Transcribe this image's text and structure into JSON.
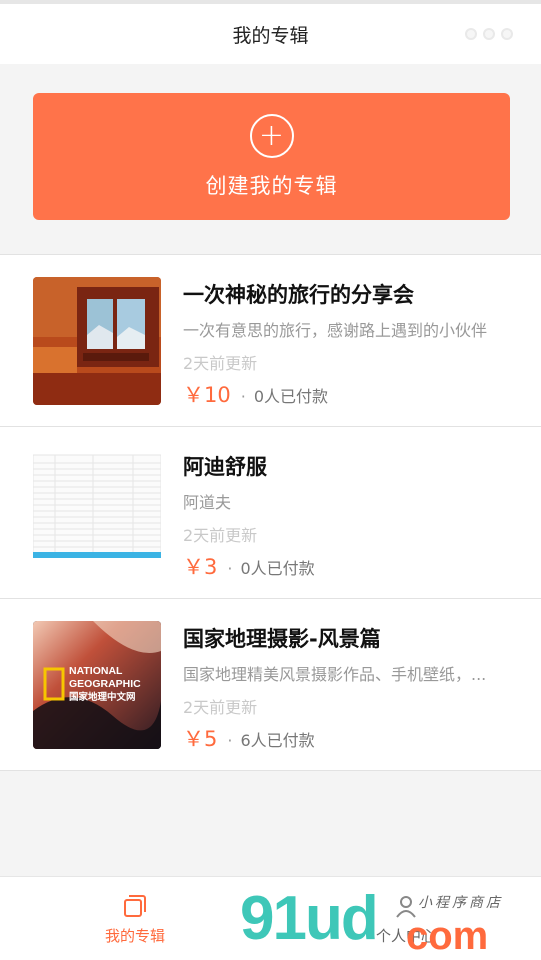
{
  "header": {
    "title": "我的专辑"
  },
  "create": {
    "label": "创建我的专辑",
    "icon": "plus-circle-icon"
  },
  "albums": [
    {
      "title": "一次神秘的旅行的分享会",
      "description": "一次有意思的旅行，感谢路上遇到的小伙伴",
      "updated": "2天前更新",
      "price": "￥10",
      "paid": "0人已付款"
    },
    {
      "title": "阿迪舒服",
      "description": "阿道夫",
      "updated": "2天前更新",
      "price": "￥3",
      "paid": "0人已付款"
    },
    {
      "title": "国家地理摄影-风景篇",
      "description": "国家地理精美风景摄影作品、手机壁纸，...",
      "updated": "2天前更新",
      "price": "￥5",
      "paid": "6人已付款",
      "thumb_text": [
        "NATIONAL",
        "GEOGRAPHIC",
        "国家地理中文网"
      ]
    }
  ],
  "tabbar": {
    "tabs": [
      {
        "label": "我的专辑",
        "icon": "album-icon",
        "active": true
      },
      {
        "label": "个人中心",
        "icon": "user-icon",
        "active": false
      }
    ]
  },
  "watermark": {
    "brand": "91ud",
    "domain": "com",
    "tagline": "小程序商店"
  },
  "colors": {
    "accent": "#ff734a",
    "price": "#ff6a3d"
  }
}
